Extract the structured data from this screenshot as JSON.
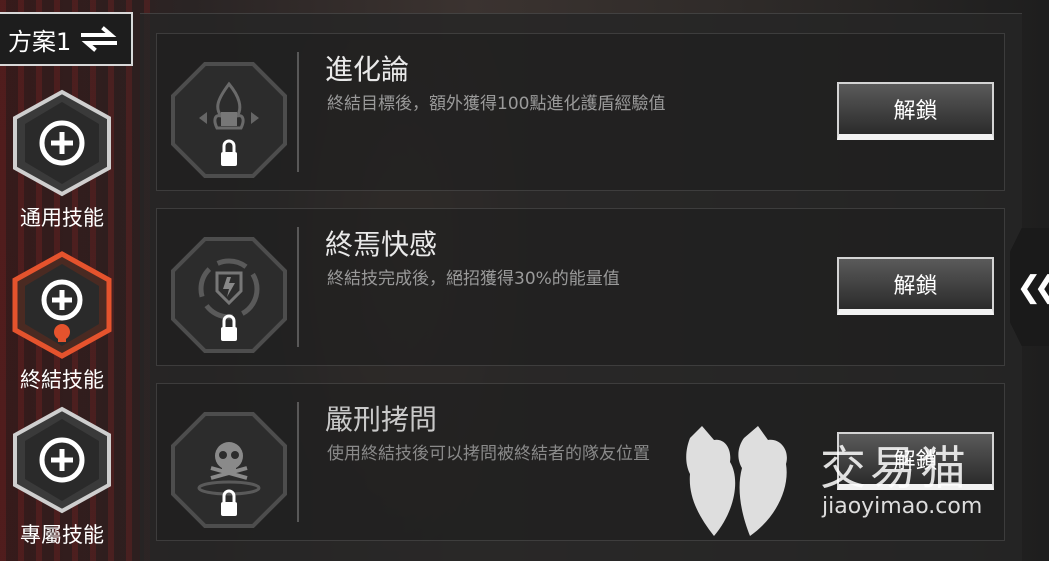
{
  "scheme": {
    "label": "方案1",
    "icon": "swap-arrows-icon"
  },
  "categories": [
    {
      "label": "通用技能",
      "icon": "plus-circle-hex-icon",
      "active": false
    },
    {
      "label": "終結技能",
      "icon": "plus-circle-skull-hex-icon",
      "active": true
    },
    {
      "label": "專屬技能",
      "icon": "plus-circle-hex-icon",
      "active": false
    }
  ],
  "skills": [
    {
      "title": "進化論",
      "desc": "終結目標後，額外獲得100點進化護盾經驗值",
      "button": "解鎖",
      "icon": "flame-armor-emblem-icon",
      "locked": true
    },
    {
      "title": "終焉快感",
      "desc": "終結技完成後，絕招獲得30%的能量值",
      "button": "解鎖",
      "icon": "ultimate-shield-emblem-icon",
      "locked": true
    },
    {
      "title": "嚴刑拷問",
      "desc": "使用終結技後可以拷問被終結者的隊友位置",
      "button": "解鎖",
      "icon": "skull-emblem-icon",
      "locked": true
    }
  ],
  "collapse": {
    "icon": "double-chevron-left-icon"
  },
  "watermark": {
    "text": "交易猫",
    "url": "jiaoyimao.com",
    "icon": "cat-logo-icon"
  },
  "colors": {
    "active_accent": "#e5532d",
    "panel": "#262626",
    "button_border": "#d4d4d4"
  }
}
